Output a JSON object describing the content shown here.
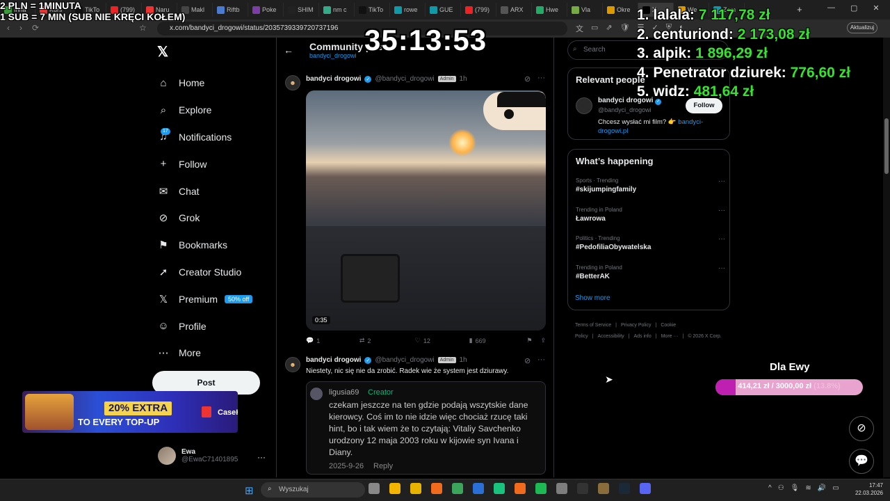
{
  "browser": {
    "tabs": [
      {
        "label": "Inna",
        "color": "#3a9b3a"
      },
      {
        "label": "Kurs",
        "color": "#e33"
      },
      {
        "label": "TikTo",
        "color": "#111"
      },
      {
        "label": "(799)",
        "color": "#e22"
      },
      {
        "label": "Naru",
        "color": "#e33"
      },
      {
        "label": "Makl",
        "color": "#444"
      },
      {
        "label": "Riftb",
        "color": "#4a7bd0"
      },
      {
        "label": "Poke",
        "color": "#7b3ea6"
      },
      {
        "label": "SHIM",
        "color": "#222"
      },
      {
        "label": "nm c",
        "color": "#3a8"
      },
      {
        "label": "TikTo",
        "color": "#111"
      },
      {
        "label": "rowe",
        "color": "#19a"
      },
      {
        "label": "GUE",
        "color": "#19a"
      },
      {
        "label": "(799)",
        "color": "#e22"
      },
      {
        "label": "ARX",
        "color": "#555"
      },
      {
        "label": "Hwe",
        "color": "#2a6"
      },
      {
        "label": "Vla",
        "color": "#7a4"
      },
      {
        "label": "Okre",
        "color": "#d90"
      },
      {
        "label": "X",
        "color": "#000",
        "active": true
      },
      {
        "label": "We",
        "color": "#d90"
      },
      {
        "label": "Zam",
        "color": "#19a"
      }
    ],
    "url": "x.com/bandyci_drogowi/status/2035739339720737196",
    "update_label": "Aktualizuj",
    "nav_icons": [
      "‹",
      "›",
      "⟳"
    ],
    "extension_icons": [
      "文",
      "▭",
      "⇗",
      "🛡",
      "☰",
      "✓",
      "⛨",
      "◐"
    ]
  },
  "overlay": {
    "donate_line1": "2 PLN = 1MINUTA",
    "donate_line2": "1 SUB = 7 MIN (SUB NIE KRĘCI KOŁEM)",
    "timer": "35:13:53",
    "leaderboard": [
      {
        "rank": "1.",
        "name": "lalala:",
        "amount": "7 117,78 zł"
      },
      {
        "rank": "2.",
        "name": "centuriond:",
        "amount": "2 173,08 zł"
      },
      {
        "rank": "3.",
        "name": "alpik:",
        "amount": "1 896,29 zł"
      },
      {
        "rank": "4.",
        "name": "Penetrator dziurek:",
        "amount": "776,60 zł"
      },
      {
        "rank": "5.",
        "name": "widz:",
        "amount": "481,64 zł"
      }
    ],
    "goal": {
      "title": "Dla Ewy",
      "current": "414,21 zł",
      "target": "3000,00 zł",
      "percent_text": "(13.8%)",
      "fraction": 0.138
    }
  },
  "sidenav": {
    "items": [
      {
        "label": "Home",
        "icon": "⌂",
        "name": "home"
      },
      {
        "label": "Explore",
        "icon": "⌕",
        "name": "explore"
      },
      {
        "label": "Notifications",
        "icon": "♫",
        "name": "notifications",
        "badge": "17"
      },
      {
        "label": "Follow",
        "icon": "+",
        "name": "follow"
      },
      {
        "label": "Chat",
        "icon": "✉",
        "name": "chat"
      },
      {
        "label": "Grok",
        "icon": "⊘",
        "name": "grok"
      },
      {
        "label": "Bookmarks",
        "icon": "⚑",
        "name": "bookmarks"
      },
      {
        "label": "Creator Studio",
        "icon": "➚",
        "name": "creator-studio"
      },
      {
        "label": "Premium",
        "icon": "𝕏",
        "name": "premium",
        "promo": "50% off"
      },
      {
        "label": "Profile",
        "icon": "☺",
        "name": "profile"
      },
      {
        "label": "More",
        "icon": "⋯",
        "name": "more"
      }
    ],
    "post_label": "Post",
    "account_name": "Ewa",
    "account_handle": "@EwaC71401895"
  },
  "ad": {
    "extra": "20% EXTRA",
    "topup": "TO EVERY TOP-UP",
    "brand": "CaseHug"
  },
  "thread": {
    "title": "Community post",
    "subtitle": "bandyci_drogowi",
    "tweet1": {
      "author": "bandyci drogowi",
      "handle": "@bandyci_drogowi",
      "badge": "Admin",
      "time": "1h",
      "video_duration": "0:35",
      "replies": "1",
      "reposts": "2",
      "likes": "12",
      "views": "669"
    },
    "tweet2": {
      "author": "bandyci drogowi",
      "handle": "@bandyci_drogowi",
      "badge": "Admin",
      "time": "1h",
      "text": "Niestety, nic się nie da zrobić. Radek wie że system jest dziurawy.",
      "quote": {
        "author": "ligusia69",
        "role": "Creator",
        "text": "czekam jeszcze na ten gdzie podają wszytskie dane kierowcy. Coś im to nie idzie więc chociaż rzucę taki hint, bo i tak wiem że to czytają: Vitaliy Savchenko urodzony 12 maja 2003 roku w kijowie syn Ivana i Diany.",
        "date": "2025-9-26",
        "reply_label": "Reply"
      }
    }
  },
  "rightcol": {
    "search_placeholder": "Search",
    "relevant_title": "Relevant people",
    "relevant_name": "bandyci drogowi",
    "relevant_handle": "@bandyci_drogowi",
    "relevant_bio": "Chcesz wysłać mi film? 👉 ",
    "relevant_link": "bandyci-drogowi.pl",
    "follow_label": "Follow",
    "trends_title": "What’s happening",
    "trends": [
      {
        "category": "Sports · Trending",
        "tag": "#skijumpingfamily"
      },
      {
        "category": "Trending in Poland",
        "tag": "Ławrowa"
      },
      {
        "category": "Politics · Trending",
        "tag": "#PedofiliaObywatelska"
      },
      {
        "category": "Trending in Poland",
        "tag": "#BetterAK"
      }
    ],
    "show_more": "Show more",
    "footer": [
      "Terms of Service",
      "Privacy Policy",
      "Cookie Policy",
      "Accessibility",
      "Ads info",
      "More ···",
      "© 2026 X Corp."
    ]
  },
  "taskbar": {
    "search_placeholder": "Wyszukaj",
    "time": "17:47",
    "date": "22.03.2026",
    "apps": [
      "#888",
      "#f5b400",
      "#e8b200",
      "#f26b1d",
      "#3ba55c",
      "#2a6fd6",
      "#19c37d",
      "#f26b1d",
      "#1db954",
      "#7d7d7d",
      "#333",
      "#8a6d3b",
      "#1b2838",
      "#5865f2"
    ]
  }
}
